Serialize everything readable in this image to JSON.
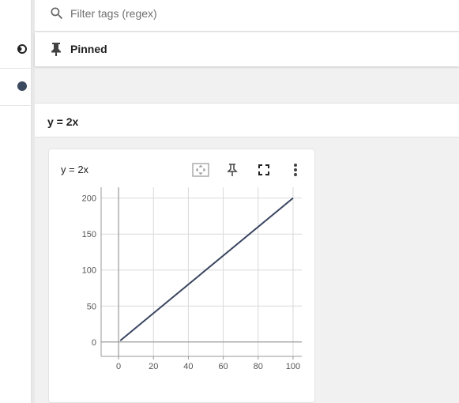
{
  "filter": {
    "placeholder": "Filter tags (regex)",
    "value": ""
  },
  "pinned": {
    "label": "Pinned"
  },
  "group": {
    "title": "y = 2x"
  },
  "card": {
    "title": "y = 2x",
    "tools": [
      {
        "icon": "fit-domain-icon"
      },
      {
        "icon": "pin-icon"
      },
      {
        "icon": "fullscreen-icon"
      },
      {
        "icon": "more-vert-icon"
      }
    ]
  },
  "colors": {
    "line": "#3a4660",
    "grid": "#d9d9d9",
    "axis": "#999999"
  },
  "chart_data": {
    "type": "line",
    "title": "y = 2x",
    "xlabel": "",
    "ylabel": "",
    "xlim": [
      -10,
      105
    ],
    "ylim": [
      -20,
      215
    ],
    "x_ticks": [
      0,
      20,
      40,
      60,
      80,
      100
    ],
    "y_ticks": [
      0,
      50,
      100,
      150,
      200
    ],
    "grid": true,
    "series": [
      {
        "x": [
          1,
          100
        ],
        "values": [
          2,
          200
        ]
      }
    ]
  }
}
